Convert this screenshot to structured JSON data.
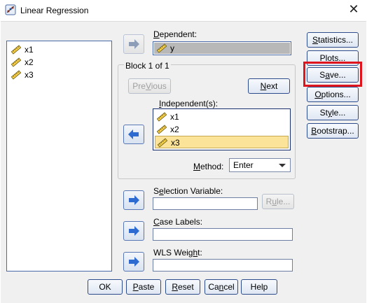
{
  "window": {
    "title": "Linear Regression",
    "close_glyph": "✕"
  },
  "source_vars": [
    {
      "name": "x1",
      "icon": "ruler-scale-icon"
    },
    {
      "name": "x2",
      "icon": "ruler-scale-icon"
    },
    {
      "name": "x3",
      "icon": "ruler-scale-icon"
    }
  ],
  "dependent": {
    "label_u": "D",
    "label_rest": "ependent:",
    "value": "y"
  },
  "block": {
    "title": "Block 1 of 1",
    "previous_u": "V",
    "previous_pre": "Pre",
    "previous_post": "ious",
    "next_u": "N",
    "next_rest": "ext"
  },
  "independents": {
    "label_pre": "",
    "label_u": "I",
    "label_rest": "ndependent(s):",
    "items": [
      "x1",
      "x2",
      "x3"
    ],
    "selected_index": 2
  },
  "method": {
    "label_u": "M",
    "label_rest": "ethod:",
    "value": "Enter"
  },
  "selection_var": {
    "label_u": "e",
    "label_pre": "S",
    "label_rest": "lection Variable:",
    "rule_u": "u",
    "rule_pre": "R",
    "rule_post": "le..."
  },
  "case_labels": {
    "label_u": "C",
    "label_rest": "ase Labels:"
  },
  "wls": {
    "label_pre": "WLS Weig",
    "label_u": "h",
    "label_rest": "t:"
  },
  "side_buttons": [
    {
      "pre": "",
      "u": "S",
      "post": "tatistics..."
    },
    {
      "pre": "P",
      "u": "l",
      "post": "ots..."
    },
    {
      "pre": "S",
      "u": "a",
      "post": "ve..."
    },
    {
      "pre": "",
      "u": "O",
      "post": "ptions..."
    },
    {
      "pre": "St",
      "u": "y",
      "post": "le..."
    },
    {
      "pre": "",
      "u": "B",
      "post": "ootstrap..."
    }
  ],
  "bottom_buttons": [
    {
      "pre": "OK",
      "u": "",
      "post": ""
    },
    {
      "pre": "",
      "u": "P",
      "post": "aste"
    },
    {
      "pre": "",
      "u": "R",
      "post": "eset"
    },
    {
      "pre": "Ca",
      "u": "n",
      "post": "cel"
    },
    {
      "pre": "Help",
      "u": "",
      "post": ""
    }
  ],
  "colors": {
    "highlight": "#e0141c",
    "selected_row": "#fbe39a",
    "accent_border": "#2c4c8c"
  }
}
